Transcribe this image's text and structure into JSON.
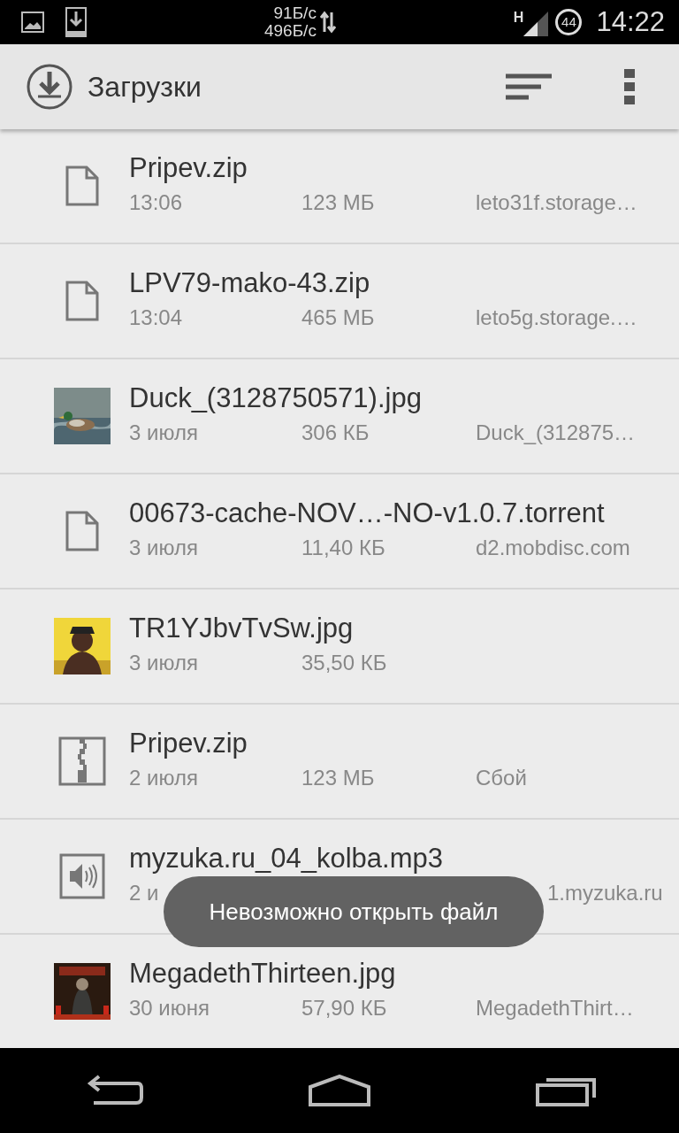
{
  "status_bar": {
    "speed_down": "91Б/с",
    "speed_up": "496Б/с",
    "network": "H",
    "battery": "44",
    "time": "14:22"
  },
  "action_bar": {
    "title": "Загрузки"
  },
  "downloads": [
    {
      "kind": "file",
      "name": "Pripev.zip",
      "date": "13:06",
      "size": "123 МБ",
      "source": "leto31f.storage…"
    },
    {
      "kind": "file",
      "name": "LPV79-mako-43.zip",
      "date": "13:04",
      "size": "465 МБ",
      "source": "leto5g.storage.…"
    },
    {
      "kind": "picture",
      "name": "Duck_(3128750571).jpg",
      "date": "3 июля",
      "size": "306 КБ",
      "source": "Duck_(312875…"
    },
    {
      "kind": "file",
      "name": "00673-cache-NOV…-NO-v1.0.7.torrent",
      "date": "3 июля",
      "size": "11,40 КБ",
      "source": "d2.mobdisc.com"
    },
    {
      "kind": "picture",
      "name": "TR1YJbvTvSw.jpg",
      "date": "3 июля",
      "size": "35,50 КБ"
    },
    {
      "kind": "zip",
      "name": "Pripev.zip",
      "date": "2 июля",
      "size": "123 МБ",
      "source": "Сбой"
    },
    {
      "kind": "audio",
      "name": "myzuka.ru_04_kolba.mp3",
      "date": "2 и",
      "source": "1.myzuka.ru"
    },
    {
      "kind": "picture",
      "name": "MegadethThirteen.jpg",
      "date": "30 июня",
      "size": "57,90 КБ",
      "source": "MegadethThirt…"
    }
  ],
  "toast": "Невозможно открыть файл"
}
